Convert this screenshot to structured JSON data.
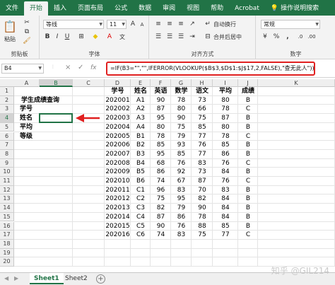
{
  "ribbon_tabs": [
    "文件",
    "开始",
    "插入",
    "页面布局",
    "公式",
    "数据",
    "审阅",
    "视图",
    "帮助",
    "Acrobat",
    "操作说明搜索"
  ],
  "active_tab": "开始",
  "ribbon": {
    "paste_label": "粘贴",
    "clipboard_label": "剪贴板",
    "font_name": "等线",
    "font_size": "11",
    "font_label": "字体",
    "bold": "B",
    "italic": "I",
    "underline": "U",
    "alignment_label": "对齐方式",
    "wrap_text": "自动换行",
    "merge_center": "合并后居中",
    "number_format": "常规",
    "number_label": "数字",
    "percent": "%",
    "comma": ",",
    "currency": "¥"
  },
  "formula_bar": {
    "name_box": "B4",
    "cancel": "×",
    "confirm": "✓",
    "fx": "fx",
    "formula": "=IF(B3=\"\",\"\",IFERROR(VLOOKUP($B$3,$D$1:$J$17,2,FALSE),\"查无此人\"))"
  },
  "columns": [
    "A",
    "B",
    "C",
    "D",
    "E",
    "F",
    "G",
    "H",
    "I",
    "J",
    "K"
  ],
  "rows": [
    "1",
    "2",
    "3",
    "4",
    "5",
    "6",
    "7",
    "8",
    "9",
    "10",
    "11",
    "12",
    "13",
    "14",
    "15",
    "16",
    "17",
    "18",
    "19",
    "20"
  ],
  "lookup_panel": {
    "title": "学生成绩查询",
    "labels": [
      "学号",
      "姓名",
      "平均",
      "等级"
    ]
  },
  "table": {
    "headers": [
      "学号",
      "姓名",
      "英语",
      "数学",
      "语文",
      "平均",
      "成绩"
    ],
    "rows": [
      [
        "202001",
        "A1",
        "90",
        "78",
        "73",
        "80",
        "B"
      ],
      [
        "202002",
        "A2",
        "87",
        "80",
        "66",
        "78",
        "C"
      ],
      [
        "202003",
        "A3",
        "95",
        "90",
        "75",
        "87",
        "B"
      ],
      [
        "202004",
        "A4",
        "80",
        "75",
        "85",
        "80",
        "B"
      ],
      [
        "202005",
        "B1",
        "78",
        "79",
        "77",
        "78",
        "C"
      ],
      [
        "202006",
        "B2",
        "85",
        "93",
        "76",
        "85",
        "B"
      ],
      [
        "202007",
        "B3",
        "95",
        "85",
        "77",
        "86",
        "B"
      ],
      [
        "202008",
        "B4",
        "68",
        "76",
        "83",
        "76",
        "C"
      ],
      [
        "202009",
        "B5",
        "86",
        "92",
        "73",
        "84",
        "B"
      ],
      [
        "202010",
        "B6",
        "74",
        "67",
        "87",
        "76",
        "C"
      ],
      [
        "202011",
        "C1",
        "96",
        "83",
        "70",
        "83",
        "B"
      ],
      [
        "202012",
        "C2",
        "75",
        "95",
        "82",
        "84",
        "B"
      ],
      [
        "202013",
        "C3",
        "82",
        "79",
        "90",
        "84",
        "B"
      ],
      [
        "202014",
        "C4",
        "87",
        "86",
        "78",
        "84",
        "B"
      ],
      [
        "202015",
        "C5",
        "90",
        "76",
        "88",
        "85",
        "B"
      ],
      [
        "202016",
        "C6",
        "74",
        "83",
        "75",
        "77",
        "C"
      ]
    ]
  },
  "sheets": [
    "Sheet1",
    "Sheet2"
  ],
  "active_sheet": "Sheet1",
  "add_sheet": "+",
  "watermark": "知乎 @GIL214",
  "accent_color": "#217346",
  "highlight_color": "#e02020",
  "icons": [
    "lightbulb-icon",
    "paste-icon",
    "cut-icon",
    "copy-icon",
    "format-painter-icon",
    "wrap-icon",
    "merge-icon",
    "arrow-icon"
  ]
}
